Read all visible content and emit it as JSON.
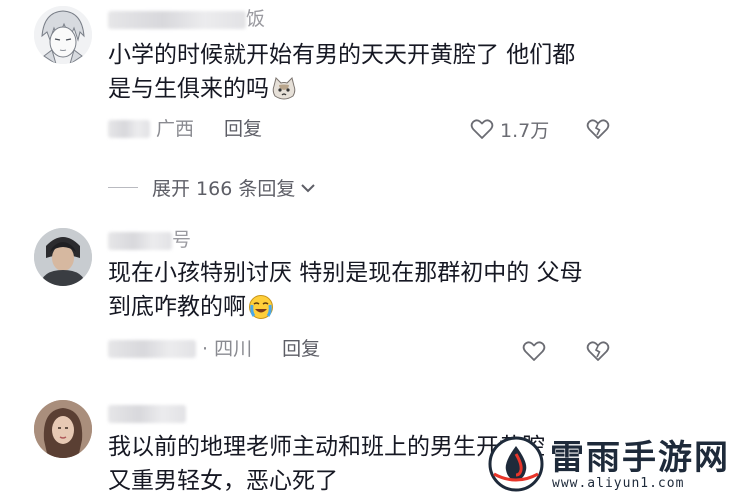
{
  "comments": [
    {
      "username_suffix": "饭",
      "lines": [
        "小学的时候就开始有男的天天开黄腔了 他们都",
        "是与生俱来的吗"
      ],
      "emoji": "cat-face-emoji",
      "location": "广西",
      "reply_label": "回复",
      "likes": "1.7万"
    },
    {
      "username_suffix": "号",
      "lines": [
        "现在小孩特别讨厌 特别是现在那群初中的 父母",
        "到底咋教的啊"
      ],
      "emoji": "crying-face-emoji",
      "location": "· 四川",
      "reply_label": "回复",
      "likes": ""
    },
    {
      "username_suffix": "",
      "lines": [
        "我以前的地理老师主动和班上的男生开黄腔",
        "又重男轻女，恶心死了"
      ]
    }
  ],
  "expand": {
    "label": "展开 166 条回复"
  },
  "watermark": {
    "title": "雷雨手游网",
    "url": "www.aliyun1.com"
  },
  "colors": {
    "text": "#161823",
    "meta": "#8a8b91",
    "watermark": "#1e2a3a",
    "watermark_accent": "#e8352a"
  }
}
